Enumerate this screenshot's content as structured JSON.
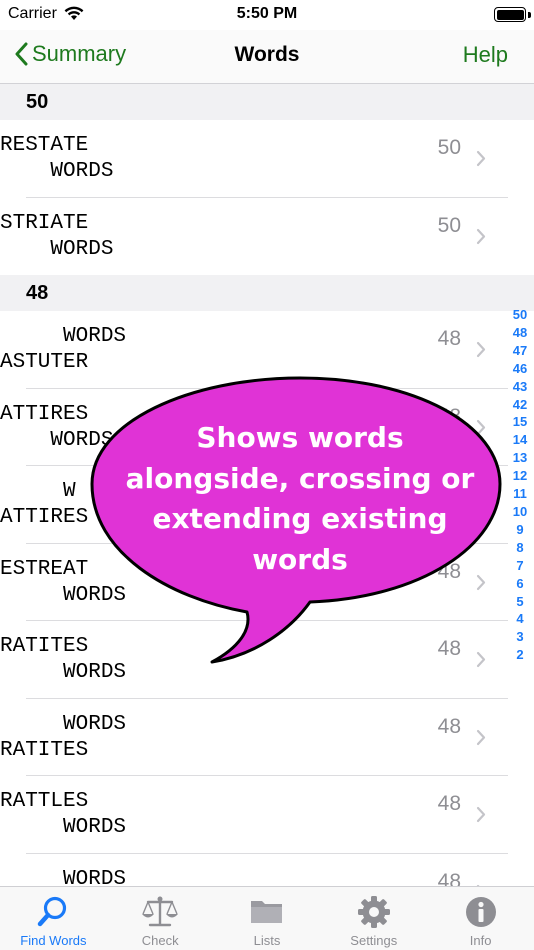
{
  "status": {
    "carrier": "Carrier",
    "time": "5:50 PM"
  },
  "nav": {
    "back_label": "Summary",
    "title": "Words",
    "help_label": "Help"
  },
  "sections": [
    {
      "header": "50",
      "rows": [
        {
          "line1": "RESTATE",
          "line2": "    WORDS",
          "score": "50"
        },
        {
          "line1": "STRIATE",
          "line2": "    WORDS",
          "score": "50"
        }
      ]
    },
    {
      "header": "48",
      "rows": [
        {
          "line1": "     WORDS",
          "line2": "ASTUTER",
          "score": "48"
        },
        {
          "line1": "ATTIRES",
          "line2": "    WORDS",
          "score": "48"
        },
        {
          "line1": "     W",
          "line2": "ATTIRES",
          "score": "48"
        },
        {
          "line1": "ESTREAT",
          "line2": "     WORDS",
          "score": "48"
        },
        {
          "line1": "RATITES",
          "line2": "     WORDS",
          "score": "48"
        },
        {
          "line1": "     WORDS",
          "line2": "RATITES",
          "score": "48"
        },
        {
          "line1": "RATTLES",
          "line2": "     WORDS",
          "score": "48"
        },
        {
          "line1": "     WORDS",
          "line2": "",
          "score": "48"
        }
      ]
    }
  ],
  "section_index": [
    "50",
    "48",
    "47",
    "46",
    "43",
    "42",
    "15",
    "14",
    "13",
    "12",
    "11",
    "10",
    "9",
    "8",
    "7",
    "6",
    "5",
    "4",
    "3",
    "2"
  ],
  "callout": {
    "lines": [
      "Shows words",
      "alongside, crossing or",
      "extending existing",
      "words"
    ],
    "color": "#e033d6"
  },
  "tabs": [
    {
      "label": "Find Words",
      "icon": "search-icon",
      "active": true
    },
    {
      "label": "Check",
      "icon": "scale-icon",
      "active": false
    },
    {
      "label": "Lists",
      "icon": "folder-icon",
      "active": false
    },
    {
      "label": "Settings",
      "icon": "gear-icon",
      "active": false
    },
    {
      "label": "Info",
      "icon": "info-icon",
      "active": false
    }
  ],
  "colors": {
    "tint": "#1e7a1e",
    "accent": "#1a7af8",
    "inactive": "#8e8e93"
  }
}
